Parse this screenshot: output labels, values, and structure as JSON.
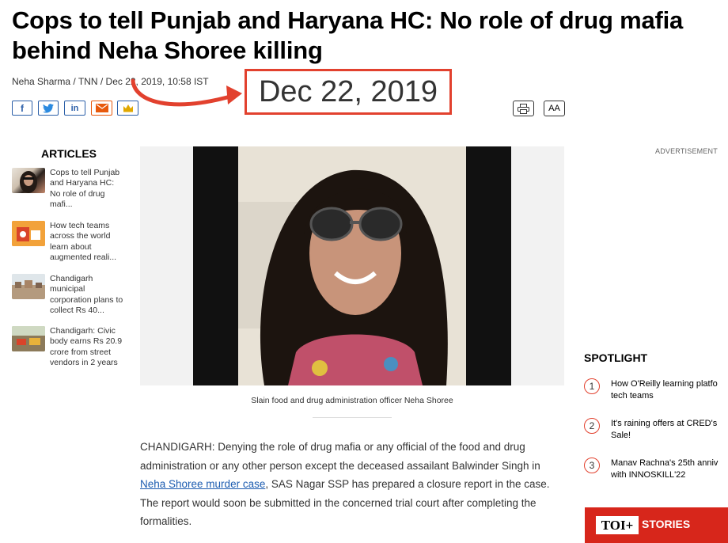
{
  "article": {
    "headline_line1": "Cops to tell Punjab and Haryana HC: No role of drug mafia",
    "headline_line2": "behind Neha Shoree killing",
    "author": "Neha Sharma",
    "source": "TNN",
    "timestamp": "Dec 22, 2019, 10:58 IST",
    "highlighted_date": "Dec 22, 2019",
    "caption": "Slain food and drug administration officer Neha Shoree",
    "body_before_link": "CHANDIGARH: Denying the role of drug mafia or any official of the food and drug administration or any other person except the deceased assailant Balwinder Singh in ",
    "body_link": "Neha Shoree murder case",
    "body_after_link": ", SAS Nagar SSP has prepared a closure report in the case. The report would soon be submitted in the concerned trial court after completing the formalities."
  },
  "toolbar": {
    "font_size_label": "AA"
  },
  "share_icons": [
    "facebook-icon",
    "twitter-icon",
    "linkedin-icon",
    "email-icon",
    "crown-icon"
  ],
  "articles": {
    "title": "ARTICLES",
    "items": [
      {
        "text": "Cops to tell Punjab and Haryana HC: No role of drug mafi..."
      },
      {
        "text": "How tech teams across the world learn about augmented reali..."
      },
      {
        "text": "Chandigarh municipal corporation plans to collect Rs 40..."
      },
      {
        "text": "Chandigarh: Civic body earns Rs 20.9 crore from street vendors in 2 years"
      }
    ]
  },
  "ad_label": "ADVERTISEMENT",
  "spotlight": {
    "title": "SPOTLIGHT",
    "items": [
      {
        "num": "1",
        "line1": "How O'Reilly learning platfo",
        "line2": "tech teams"
      },
      {
        "num": "2",
        "line1": "It's raining offers at CRED's",
        "line2": "Sale!"
      },
      {
        "num": "3",
        "line1": "Manav Rachna's 25th anniv",
        "line2": "with INNOSKILL'22"
      }
    ]
  },
  "stories": {
    "logo": "TOI+",
    "label": "STORIES"
  },
  "colors": {
    "accent_red": "#e2412e",
    "link_blue": "#1c5cb0",
    "share_blue": "#2b5fa8",
    "email_orange": "#e8590c",
    "crown_gold": "#e0a800"
  }
}
